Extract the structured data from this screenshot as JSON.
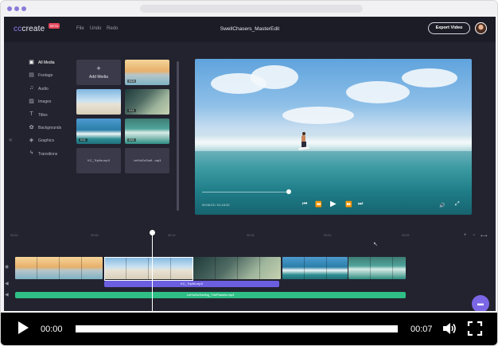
{
  "app": {
    "logo_prefix": "cc",
    "logo_suffix": "create",
    "beta_badge": "BETA",
    "project_title": "SwellChasers_MasterEdit",
    "export_label": "Export Video",
    "menu": [
      "File",
      "Undo",
      "Redo"
    ]
  },
  "sidebar": {
    "items": [
      {
        "label": "All Media",
        "icon": "media-icon",
        "glyph": "▣",
        "active": true
      },
      {
        "label": "Footage",
        "icon": "footage-icon",
        "glyph": "▤",
        "active": false
      },
      {
        "label": "Audio",
        "icon": "audio-icon",
        "glyph": "♫",
        "active": false
      },
      {
        "label": "Images",
        "icon": "image-icon",
        "glyph": "▨",
        "active": false
      },
      {
        "label": "Titles",
        "icon": "titles-icon",
        "glyph": "T",
        "active": false
      },
      {
        "label": "Backgrounds",
        "icon": "backgrounds-icon",
        "glyph": "✿",
        "active": false
      },
      {
        "label": "Graphics",
        "icon": "graphics-icon",
        "glyph": "◈",
        "active": false
      },
      {
        "label": "Transitions",
        "icon": "transitions-icon",
        "glyph": "ϟ",
        "active": false
      }
    ],
    "collapse_glyph": "«"
  },
  "media": {
    "add_label": "Add Media",
    "add_glyph": "+",
    "durations": [
      "0:13",
      "0:11",
      "0:11",
      "0:11",
      "0:11"
    ],
    "audio_files": [
      "KC_Tripfin.mp3",
      "LetYaGoSurfi...mp3"
    ]
  },
  "preview": {
    "timecode": "00:06:23 / 01:15:20",
    "controls": {
      "skip_back": "⏮",
      "rewind": "⏪",
      "play": "▶",
      "forward": "⏩",
      "skip_end": "⏭",
      "volume": "🔊",
      "fullscreen": "⤢"
    }
  },
  "timeline": {
    "ticks": [
      "00:00",
      "00:06",
      "00:10",
      "00:15",
      "00:20",
      "00:25"
    ],
    "zoom_in": "+",
    "zoom_out": "−",
    "fit": "⟷",
    "audio_clips": [
      "KC_Tripfin.mp3",
      "LetYaGoSurfing_ThePlanets.mp3"
    ]
  },
  "player": {
    "current_time": "00:00",
    "duration": "00:07",
    "progress": 0.0
  }
}
